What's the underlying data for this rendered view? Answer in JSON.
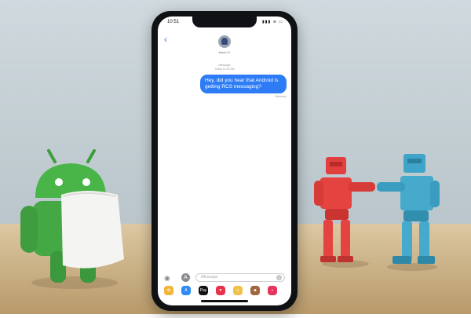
{
  "status": {
    "time": "10:51"
  },
  "nav": {
    "back": "‹"
  },
  "contact": {
    "name": "Jason G."
  },
  "thread": {
    "line1": "iMessage",
    "line2": "Today 10:15 AM"
  },
  "message": {
    "text": "Hey, did you hear that Android is getting RCS messaging?"
  },
  "delivered": "Delivered",
  "composer": {
    "placeholder": "iMessage"
  },
  "drawer": [
    "Photos",
    "App Store",
    "Apple Pay",
    "Digital Touch",
    "Animoji",
    "Memoji",
    "Search"
  ]
}
